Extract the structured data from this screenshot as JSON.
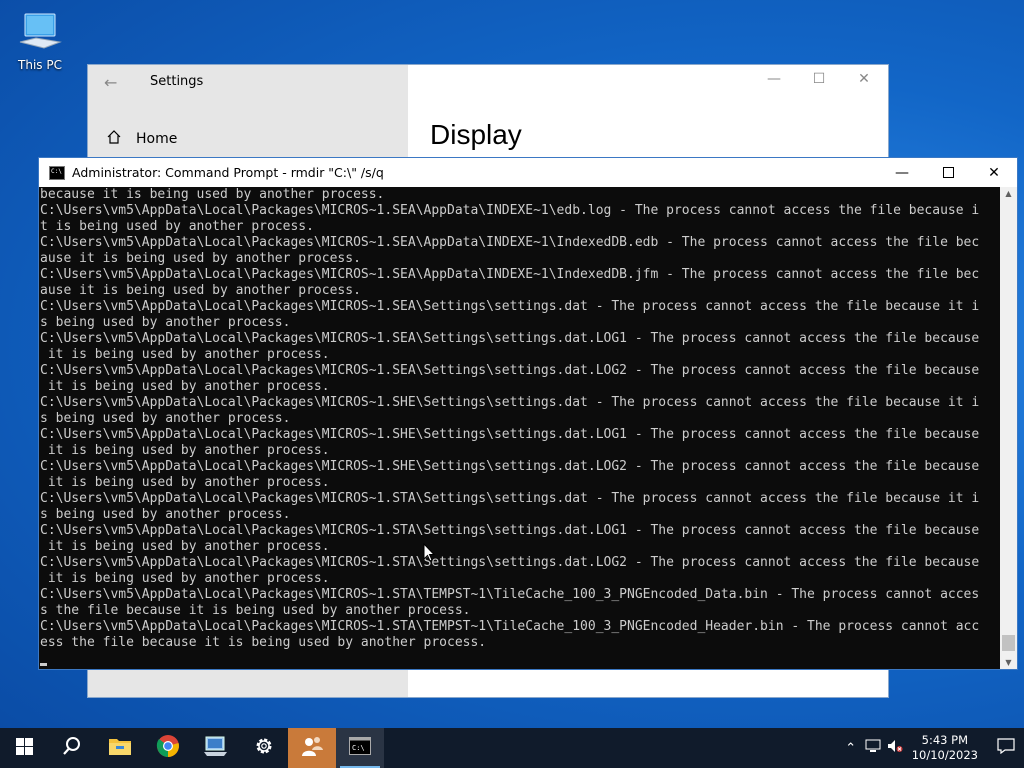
{
  "desktop": {
    "this_pc_label": "This PC"
  },
  "settings": {
    "title": "Settings",
    "home_label": "Home",
    "page_heading": "Display"
  },
  "cmd": {
    "title": "Administrator: Command Prompt - rmdir  \"C:\\\" /s/q",
    "console_text": "because it is being used by another process.\nC:\\Users\\vm5\\AppData\\Local\\Packages\\MICROS~1.SEA\\AppData\\INDEXE~1\\edb.log - The process cannot access the file because i\nt is being used by another process.\nC:\\Users\\vm5\\AppData\\Local\\Packages\\MICROS~1.SEA\\AppData\\INDEXE~1\\IndexedDB.edb - The process cannot access the file bec\nause it is being used by another process.\nC:\\Users\\vm5\\AppData\\Local\\Packages\\MICROS~1.SEA\\AppData\\INDEXE~1\\IndexedDB.jfm - The process cannot access the file bec\nause it is being used by another process.\nC:\\Users\\vm5\\AppData\\Local\\Packages\\MICROS~1.SEA\\Settings\\settings.dat - The process cannot access the file because it i\ns being used by another process.\nC:\\Users\\vm5\\AppData\\Local\\Packages\\MICROS~1.SEA\\Settings\\settings.dat.LOG1 - The process cannot access the file because\n it is being used by another process.\nC:\\Users\\vm5\\AppData\\Local\\Packages\\MICROS~1.SEA\\Settings\\settings.dat.LOG2 - The process cannot access the file because\n it is being used by another process.\nC:\\Users\\vm5\\AppData\\Local\\Packages\\MICROS~1.SHE\\Settings\\settings.dat - The process cannot access the file because it i\ns being used by another process.\nC:\\Users\\vm5\\AppData\\Local\\Packages\\MICROS~1.SHE\\Settings\\settings.dat.LOG1 - The process cannot access the file because\n it is being used by another process.\nC:\\Users\\vm5\\AppData\\Local\\Packages\\MICROS~1.SHE\\Settings\\settings.dat.LOG2 - The process cannot access the file because\n it is being used by another process.\nC:\\Users\\vm5\\AppData\\Local\\Packages\\MICROS~1.STA\\Settings\\settings.dat - The process cannot access the file because it i\ns being used by another process.\nC:\\Users\\vm5\\AppData\\Local\\Packages\\MICROS~1.STA\\Settings\\settings.dat.LOG1 - The process cannot access the file because\n it is being used by another process.\nC:\\Users\\vm5\\AppData\\Local\\Packages\\MICROS~1.STA\\Settings\\settings.dat.LOG2 - The process cannot access the file because\n it is being used by another process.\nC:\\Users\\vm5\\AppData\\Local\\Packages\\MICROS~1.STA\\TEMPST~1\\TileCache_100_3_PNGEncoded_Data.bin - The process cannot acces\ns the file because it is being used by another process.\nC:\\Users\\vm5\\AppData\\Local\\Packages\\MICROS~1.STA\\TEMPST~1\\TileCache_100_3_PNGEncoded_Header.bin - The process cannot acc\ness the file because it is being used by another process."
  },
  "taskbar": {
    "apps": [
      "start-icon",
      "search-icon",
      "file-explorer-icon",
      "chrome-icon",
      "remote-desktop-icon",
      "settings-gear-icon",
      "user-accounts-icon",
      "command-prompt-icon"
    ],
    "time": "5:43 PM",
    "date": "10/10/2023"
  },
  "colors": {
    "console_bg": "#0c0c0c",
    "console_fg": "#cccccc",
    "taskbar_bg": "#101b2b",
    "active_app": "#c97a3a"
  }
}
